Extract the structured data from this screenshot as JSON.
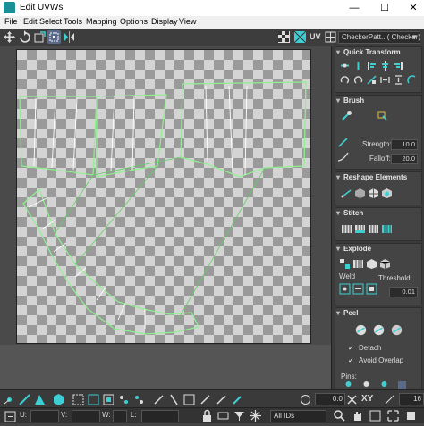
{
  "window": {
    "title": "Edit UVWs",
    "minimize": "—",
    "maximize": "☐",
    "close": "✕"
  },
  "menu": [
    "File",
    "Edit",
    "Select",
    "Tools",
    "Mapping",
    "Options",
    "Display",
    "View"
  ],
  "toolbar": {
    "uv_label": "UV",
    "texture_dropdown": "CheckerPatt...( Checker)"
  },
  "panels": {
    "quick_transform": {
      "title": "Quick Transform"
    },
    "brush": {
      "title": "Brush",
      "strength_label": "Strength:",
      "strength_value": "10.0",
      "falloff_label": "Falloff:",
      "falloff_value": "20.0"
    },
    "reshape": {
      "title": "Reshape Elements"
    },
    "stitch": {
      "title": "Stitch"
    },
    "explode": {
      "title": "Explode",
      "weld_label": "Weld",
      "threshold_label": "Threshold:",
      "threshold_value": "0.01"
    },
    "peel": {
      "title": "Peel",
      "detach_label": "Detach",
      "avoid_overlap_label": "Avoid Overlap",
      "pins_label": "Pins:"
    }
  },
  "statusbar": {
    "value_field": "0.0",
    "xy_label": "XY",
    "zoom_value": "16",
    "u_label": "U:",
    "v_label": "V:",
    "w_label": "W:",
    "l_label": "L:",
    "ids_dropdown": "All IDs"
  },
  "colors": {
    "accent": "#3ecfd4",
    "uv_edge": "#8ff08f",
    "uv_selected": "#ffffff"
  }
}
